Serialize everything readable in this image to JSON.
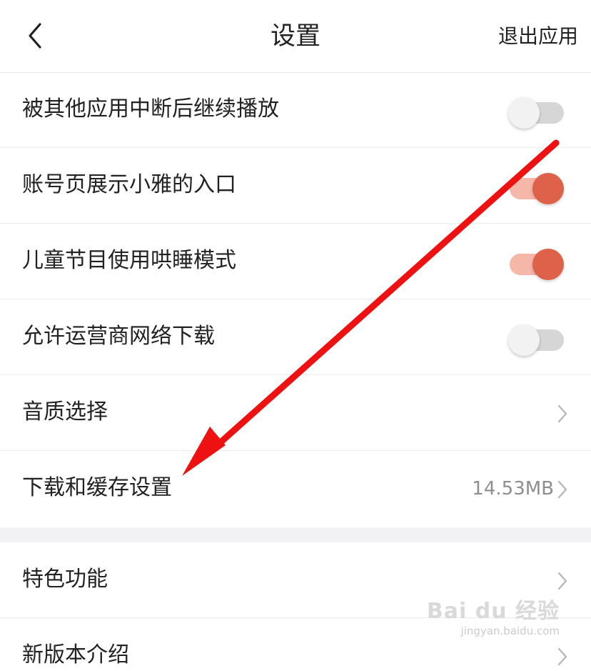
{
  "header": {
    "title": "设置",
    "exit_label": "退出应用",
    "back_icon": "chevron-left-icon"
  },
  "settings": [
    {
      "label": "被其他应用中断后继续播放",
      "control": "toggle",
      "state": "off"
    },
    {
      "label": "账号页展示小雅的入口",
      "control": "toggle",
      "state": "on"
    },
    {
      "label": "儿童节目使用哄睡模式",
      "control": "toggle",
      "state": "on"
    },
    {
      "label": "允许运营商网络下载",
      "control": "toggle",
      "state": "off"
    },
    {
      "label": "音质选择",
      "control": "chevron"
    },
    {
      "label": "下载和缓存设置",
      "control": "chevron",
      "value": "14.53MB"
    }
  ],
  "more": [
    {
      "label": "特色功能",
      "control": "chevron"
    },
    {
      "label": "新版本介绍",
      "control": "chevron"
    }
  ],
  "annotation": {
    "type": "red-arrow",
    "color": "#ee1111"
  },
  "colors": {
    "toggle_on_knob": "#dd6249",
    "toggle_on_track": "#f4b7a8",
    "toggle_off_track": "#d6d6d6",
    "divider": "#ececec",
    "section_gap": "#f2f2f4"
  },
  "watermark": {
    "logo": "Bai du 经验",
    "sub": "jingyan.baidu.com"
  }
}
